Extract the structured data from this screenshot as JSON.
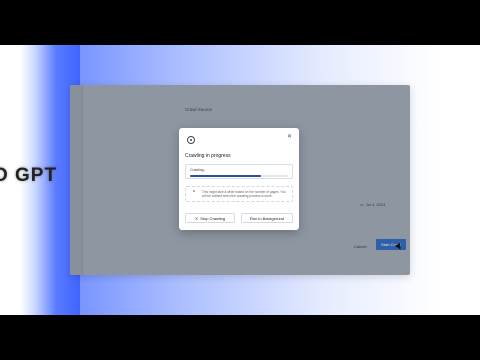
{
  "overlay_text": "D GPT",
  "background_app": {
    "source_title": "Crawl Source",
    "source_subtitle": "",
    "date_label": "Jul 4, 2024",
    "cancel_label": "Cancel",
    "start_label": "Start Crawl"
  },
  "modal": {
    "title": "Crawling in progress",
    "progress_label": "Crawling...",
    "progress_value": 0.72,
    "note": "This might take a while based on the number of pages. You will be notified when the crawling process is done.",
    "stop_label": "Stop Crawling",
    "background_label": "Run in Background",
    "close_icon": "close-icon",
    "header_icon": "target-icon"
  },
  "colors": {
    "progress_fill": "#2a4e9a",
    "primary_button": "#2f5fa8",
    "accent_glow": "#3f64ff"
  }
}
